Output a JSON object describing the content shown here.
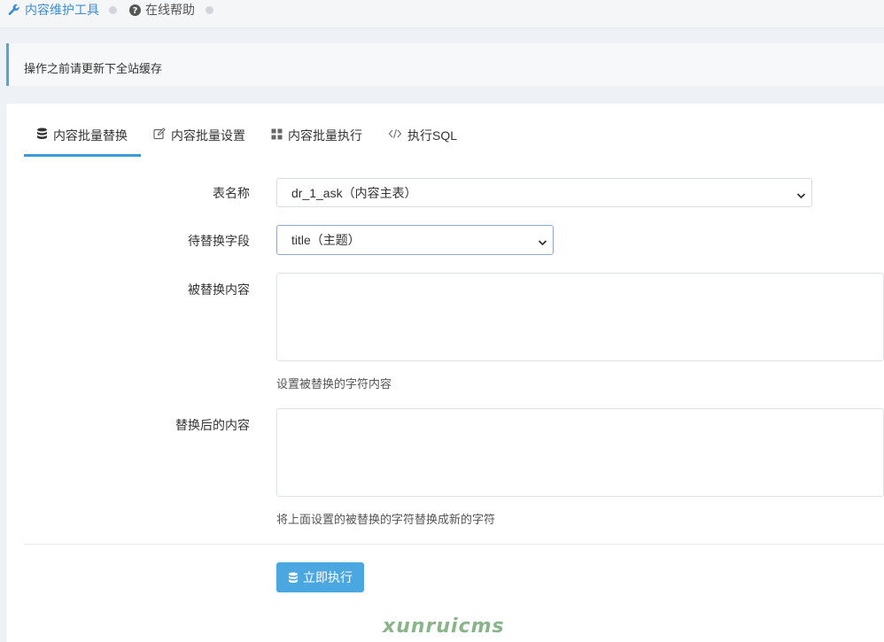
{
  "breadcrumb": {
    "items": [
      {
        "label": "内容维护工具",
        "icon": "wrench-icon"
      },
      {
        "label": "在线帮助",
        "icon": "question-circle-icon"
      }
    ]
  },
  "notice": {
    "text": "操作之前请更新下全站缓存"
  },
  "tabs": [
    {
      "label": "内容批量替换",
      "icon": "database-icon",
      "active": true
    },
    {
      "label": "内容批量设置",
      "icon": "edit-icon",
      "active": false
    },
    {
      "label": "内容批量执行",
      "icon": "grid-icon",
      "active": false
    },
    {
      "label": "执行SQL",
      "icon": "code-icon",
      "active": false
    }
  ],
  "form": {
    "table": {
      "label": "表名称",
      "value": "dr_1_ask（内容主表）"
    },
    "field": {
      "label": "待替换字段",
      "value": "title（主题）"
    },
    "search": {
      "label": "被替换内容",
      "value": "",
      "help": "设置被替换的字符内容"
    },
    "replace": {
      "label": "替换后的内容",
      "value": "",
      "help": "将上面设置的被替换的字符替换成新的字符"
    },
    "submit_label": "立即执行"
  },
  "watermark": "xunruicms",
  "colors": {
    "accent": "#3d9ad9",
    "button": "#4aa7e0",
    "link": "#3d8ed2"
  }
}
